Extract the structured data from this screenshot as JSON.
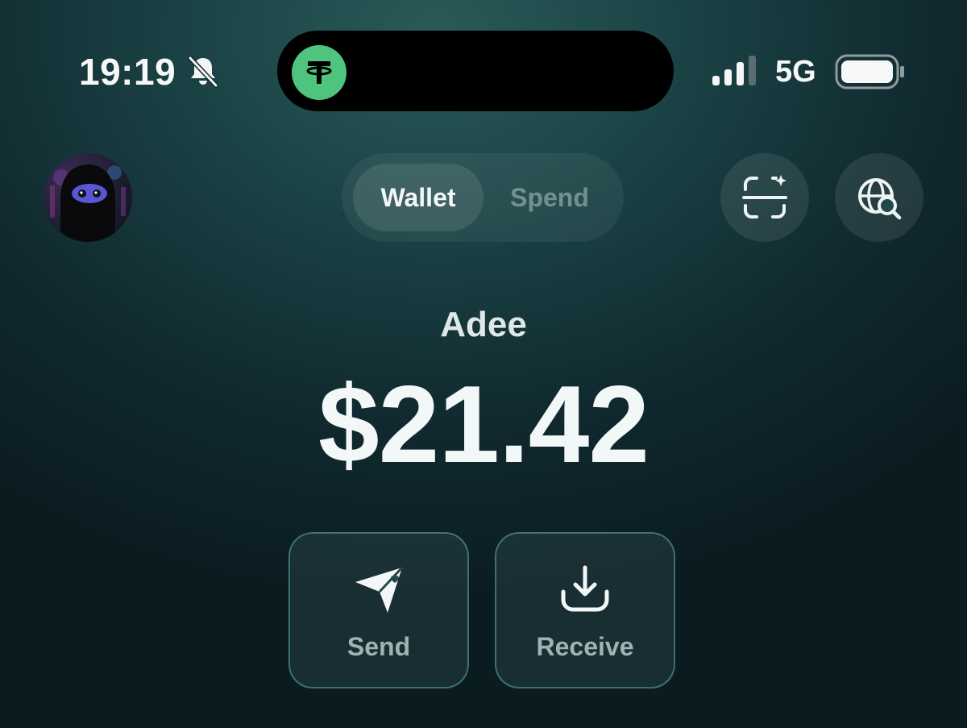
{
  "status_bar": {
    "time": "19:19",
    "network": "5G",
    "icons": [
      "bell-slash-icon",
      "tether-icon",
      "signal-icon",
      "battery-icon"
    ]
  },
  "header": {
    "avatar": "avatar",
    "tabs": [
      {
        "label": "Wallet",
        "selected": true
      },
      {
        "label": "Spend",
        "selected": false
      }
    ],
    "actions": [
      "scan-icon",
      "globe-search-icon"
    ]
  },
  "account": {
    "name": "Adee",
    "balance": "$21.42"
  },
  "actions": {
    "send_label": "Send",
    "receive_label": "Receive"
  },
  "colors": {
    "accent_green": "#4fc47f",
    "text_primary": "#f2f7f7",
    "text_muted": "#9fb3b4"
  }
}
